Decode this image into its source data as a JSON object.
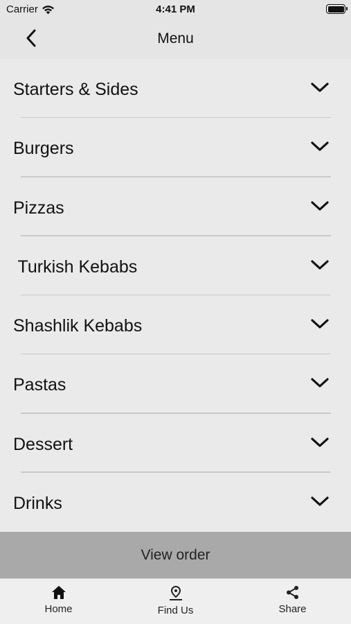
{
  "status_bar": {
    "carrier": "Carrier",
    "time": "4:41 PM"
  },
  "nav": {
    "title": "Menu",
    "back_icon": "chevron-left-icon"
  },
  "menu": {
    "items": [
      {
        "label": "Starters & Sides"
      },
      {
        "label": "Burgers"
      },
      {
        "label": "Pizzas"
      },
      {
        "label": " Turkish Kebabs"
      },
      {
        "label": "Shashlik Kebabs"
      },
      {
        "label": "Pastas"
      },
      {
        "label": "Dessert"
      },
      {
        "label": "Drinks"
      }
    ]
  },
  "view_order": {
    "label": "View order"
  },
  "tabs": [
    {
      "label": "Home",
      "icon": "home-icon"
    },
    {
      "label": "Find Us",
      "icon": "map-pin-icon"
    },
    {
      "label": "Share",
      "icon": "share-icon"
    }
  ]
}
